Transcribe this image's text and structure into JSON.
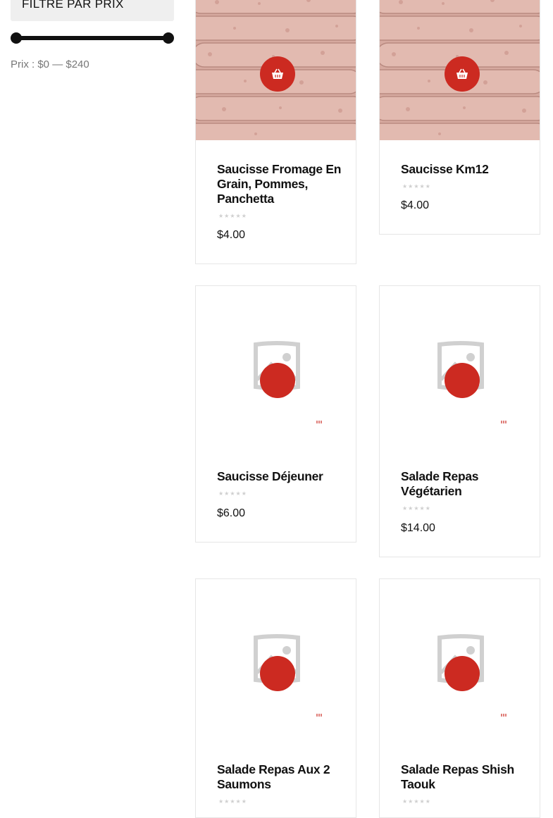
{
  "filter": {
    "title": "FILTRE PAR PRIX",
    "min_value": 0,
    "max_value": 240,
    "price_label": "Prix :",
    "min_label": "$0",
    "separator": "—",
    "max_label": "$240"
  },
  "colors": {
    "accent": "#cc2a21",
    "slider": "#111111",
    "muted_text": "#777777",
    "border": "#e6e6e6"
  },
  "products": [
    {
      "title": "Saucisse Fromage En Grain, Pommes, Panchetta",
      "price": "$4.00",
      "rating": 0,
      "image": "sausage-photo"
    },
    {
      "title": "Saucisse Km12",
      "price": "$4.00",
      "rating": 0,
      "image": "sausage-photo"
    },
    {
      "title": "Saucisse Déjeuner",
      "price": "$6.00",
      "rating": 0,
      "image": "placeholder-icon"
    },
    {
      "title": "Salade Repas Végétarien",
      "price": "$14.00",
      "rating": 0,
      "image": "placeholder-icon"
    },
    {
      "title": "Salade Repas Aux 2 Saumons",
      "price": "",
      "rating": 0,
      "image": "placeholder-icon"
    },
    {
      "title": "Salade Repas Shish Taouk",
      "price": "",
      "rating": 0,
      "image": "placeholder-icon"
    }
  ],
  "icons": {
    "cart": "basket-icon",
    "rating": "star-rating-icon"
  },
  "stars_text": "★★★★★"
}
